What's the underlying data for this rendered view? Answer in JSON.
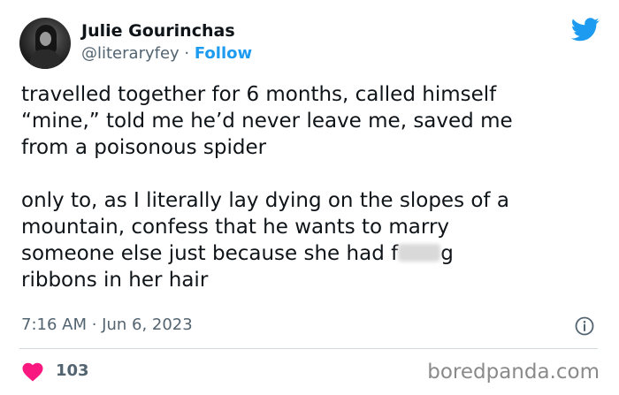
{
  "tweet": {
    "author_name": "Julie Gourinchas",
    "handle": "@literaryfey",
    "separator": " · ",
    "follow_label": "Follow",
    "text_part1": "travelled together for 6 months, called himself\n“mine,” told me he’d never leave me, saved me\nfrom a poisonous spider\n\nonly to, as I literally lay dying on the slopes of a\nmountain, confess that he wants to marry\nsomeone else just because she had f",
    "text_part2": "g\nribbons in her hair",
    "timestamp": "7:16 AM · Jun 6, 2023",
    "like_count": "103"
  },
  "watermark": "boredpanda.com",
  "colors": {
    "twitter_blue": "#1d9bf0",
    "like_red": "#f91880",
    "secondary_text": "#536471"
  },
  "icons": {
    "brand": "twitter-bird-icon",
    "info": "info-icon",
    "like": "heart-icon"
  }
}
